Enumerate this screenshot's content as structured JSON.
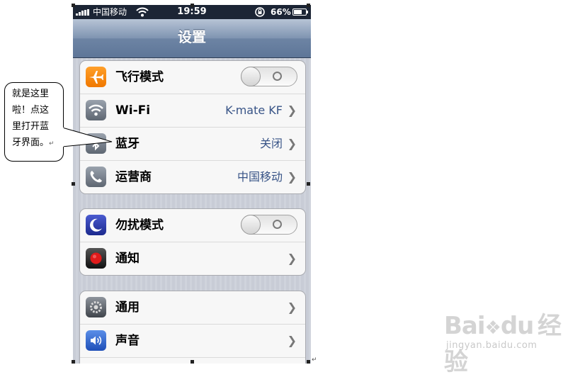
{
  "status_bar": {
    "carrier": "中国移动",
    "time": "19:59",
    "battery_percent": "66%",
    "battery_level": 0.66
  },
  "nav": {
    "title": "设置"
  },
  "groups": [
    {
      "rows": [
        {
          "label": "飞行模式",
          "icon": "airplane-icon",
          "type": "toggle",
          "state": "off"
        },
        {
          "label": "Wi-Fi",
          "icon": "wifi-icon",
          "value": "K-mate KF",
          "type": "disclosure"
        },
        {
          "label": "蓝牙",
          "icon": "bluetooth-icon",
          "value": "关闭",
          "type": "disclosure"
        },
        {
          "label": "运营商",
          "icon": "phone-icon",
          "value": "中国移动",
          "type": "disclosure"
        }
      ]
    },
    {
      "rows": [
        {
          "label": "勿扰模式",
          "icon": "moon-icon",
          "type": "toggle",
          "state": "off"
        },
        {
          "label": "通知",
          "icon": "notification-icon",
          "type": "disclosure"
        }
      ]
    },
    {
      "rows": [
        {
          "label": "通用",
          "icon": "gear-icon",
          "type": "disclosure"
        },
        {
          "label": "声音",
          "icon": "speaker-icon",
          "type": "disclosure"
        }
      ]
    }
  ],
  "callout": {
    "lines": [
      "就是这里",
      "啦！点这",
      "里打开蓝",
      "牙界面。"
    ]
  },
  "watermark": {
    "logo": "Bai",
    "logo2": "du",
    "jingyan": "经验",
    "url": "jingyan.baidu.com"
  },
  "colors": {
    "navbar": "#6d84a4",
    "value_text": "#385487",
    "group_bg": "#f7f7f7"
  }
}
